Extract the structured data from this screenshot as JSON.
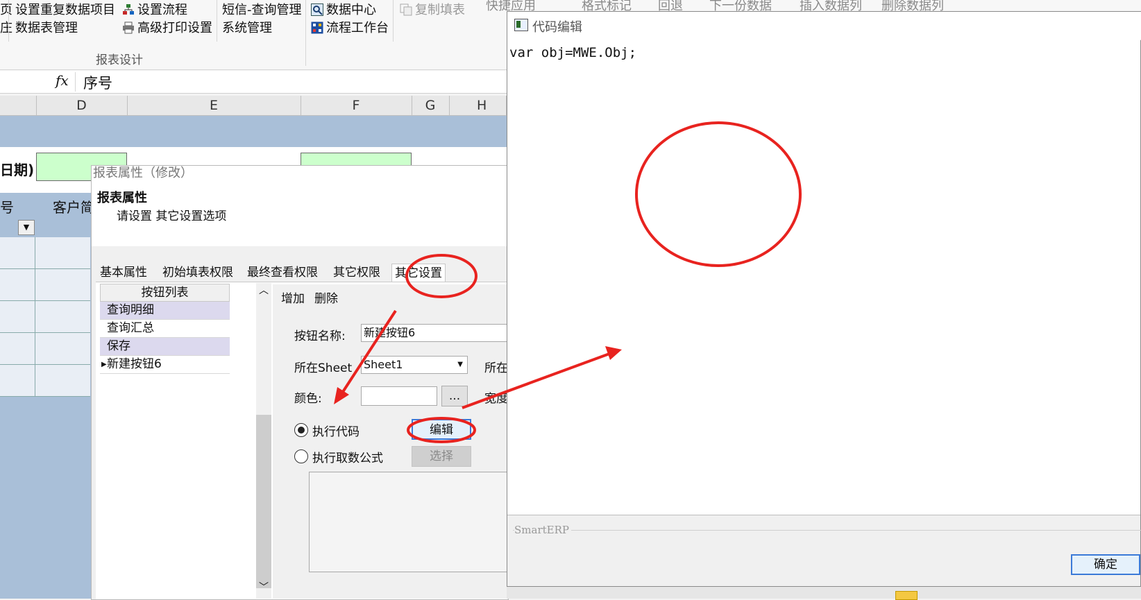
{
  "ribbon": {
    "col1": {
      "item1": "设置重复数据项目",
      "item2": "数据表管理",
      "left1": "页",
      "left2": "庄"
    },
    "col2": {
      "item1": "设置流程",
      "item2": "高级打印设置"
    },
    "col3": {
      "item1": "短信-查询管理",
      "item2": "系统管理"
    },
    "col4": {
      "item1": "数据中心",
      "item2": "流程工作台"
    },
    "copy_fill": "复制填表",
    "group_label": "报表设计",
    "top_tools": [
      "快捷应用",
      "格式标记",
      "回退",
      "下一份数据",
      "插入数据列",
      "删除数据列"
    ]
  },
  "formula_bar": {
    "fx": "fx",
    "value": "序号"
  },
  "columns": [
    "D",
    "E",
    "F",
    "G",
    "H"
  ],
  "sheet": {
    "row_label_date": "日期)",
    "row_label_no": "号",
    "row_label_customer": "客户简"
  },
  "report_dialog": {
    "title": "报表属性（修改）",
    "heading": "报表属性",
    "subheading": "请设置 其它设置选项",
    "tabs": [
      "基本属性",
      "初始填表权限",
      "最终查看权限",
      "其它权限",
      "其它设置"
    ],
    "button_list": {
      "header": "按钮列表",
      "rows": [
        "查询明细",
        "查询汇总",
        "保存",
        "新建按钮6"
      ]
    },
    "toolbar": {
      "add": "增加",
      "delete": "删除"
    },
    "fields": {
      "name_label": "按钮名称:",
      "name_value": "新建按钮6",
      "sheet_label": "所在Sheet",
      "sheet_value": "Sheet1",
      "color_label": "颜色:",
      "ellipsis": "...",
      "right_label_1": "所在",
      "right_label_2": "宽度"
    },
    "exec_code": "执行代码",
    "exec_formula": "执行取数公式",
    "edit_button": "编辑",
    "select_button": "选择"
  },
  "code_editor": {
    "title": "代码编辑",
    "code": "var obj=MWE.Obj;",
    "footer_group": "SmartERP",
    "ok_button": "确定"
  },
  "colors": {
    "annotation_red": "#e8231f",
    "selection_purple": "#dcd9ee",
    "sheet_blue": "#a9bfd8",
    "cell_green": "#ccffcc"
  }
}
